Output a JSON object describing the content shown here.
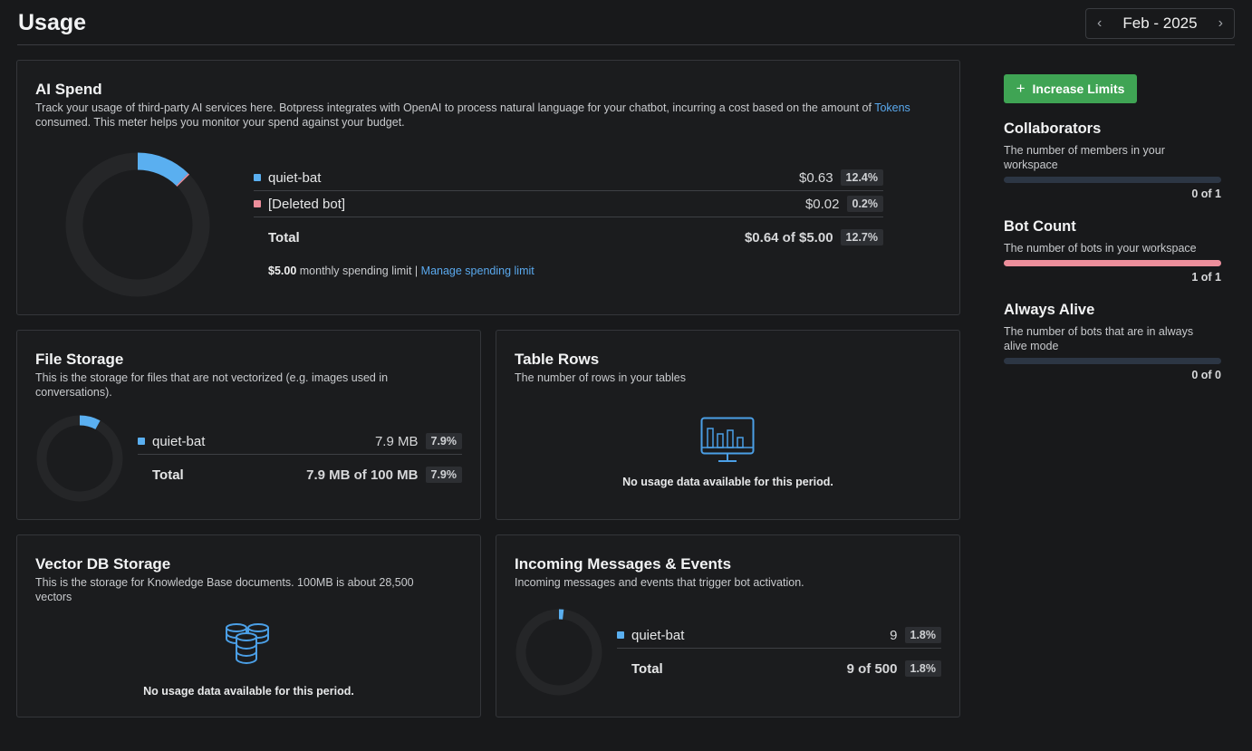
{
  "header": {
    "title": "Usage",
    "month": "Feb - 2025",
    "prev_icon": "chevron-left-icon",
    "next_icon": "chevron-right-icon"
  },
  "ai_spend": {
    "title": "AI Spend",
    "desc_part1": "Track your usage of third-party AI services here. Botpress integrates with OpenAI to process natural language for your chatbot, incurring a cost based on the amount of",
    "desc_link": "Tokens",
    "desc_part2": " consumed. This meter helps you monitor your spend against your budget.",
    "rows": [
      {
        "name": "quiet-bat",
        "value": "$0.63",
        "pct": "12.4%",
        "color": "#5aaff0",
        "fraction": 0.124
      },
      {
        "name": "[Deleted bot]",
        "value": "$0.02",
        "pct": "0.2%",
        "color": "#ec8e9b",
        "fraction": 0.002
      }
    ],
    "total": {
      "label": "Total",
      "value": "$0.64 of $5.00",
      "pct": "12.7%"
    },
    "limit_amount": "$5.00",
    "limit_text": " monthly spending limit",
    "limit_sep": "|",
    "limit_link": "Manage spending limit"
  },
  "file_storage": {
    "title": "File Storage",
    "desc": "This is the storage for files that are not vectorized (e.g. images used in conversations).",
    "rows": [
      {
        "name": "quiet-bat",
        "value": "7.9 MB",
        "pct": "7.9%",
        "color": "#5aaff0",
        "fraction": 0.079
      }
    ],
    "total": {
      "label": "Total",
      "value": "7.9 MB of 100 MB",
      "pct": "7.9%"
    }
  },
  "table_rows": {
    "title": "Table Rows",
    "desc": "The number of rows in your tables",
    "icon": "monitor-chart-icon",
    "empty": "No usage data available for this period."
  },
  "vector_db": {
    "title": "Vector DB Storage",
    "desc": "This is the storage for Knowledge Base documents. 100MB is about 28,500 vectors",
    "icon": "database-icon",
    "empty": "No usage data available for this period."
  },
  "messages": {
    "title": "Incoming Messages & Events",
    "desc": "Incoming messages and events that trigger bot activation.",
    "rows": [
      {
        "name": "quiet-bat",
        "value": "9",
        "pct": "1.8%",
        "color": "#5aaff0",
        "fraction": 0.018
      }
    ],
    "total": {
      "label": "Total",
      "value": "9 of 500",
      "pct": "1.8%"
    }
  },
  "sidebar": {
    "button_label": "Increase Limits",
    "button_icon": "plus-icon",
    "accent": "#3fa454",
    "collaborators": {
      "title": "Collaborators",
      "desc": "The number of members in your workspace",
      "count": "0 of 1",
      "fraction": 0
    },
    "bot_count": {
      "title": "Bot Count",
      "desc": "The number of bots in your workspace",
      "count": "1 of 1",
      "fraction": 1,
      "color": "#ec8e9b"
    },
    "always_alive": {
      "title": "Always Alive",
      "desc": "The number of bots that are in always alive mode",
      "count": "0 of 0",
      "fraction": 0
    }
  }
}
